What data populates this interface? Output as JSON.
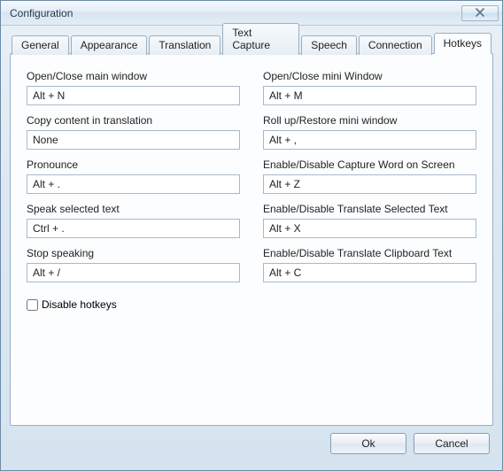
{
  "window": {
    "title": "Configuration"
  },
  "tabs": {
    "general": "General",
    "appearance": "Appearance",
    "translation": "Translation",
    "textcapture": "Text Capture",
    "speech": "Speech",
    "connection": "Connection",
    "hotkeys": "Hotkeys"
  },
  "hotkeys": {
    "open_main": {
      "label": "Open/Close main window",
      "value": "Alt + N"
    },
    "open_mini": {
      "label": "Open/Close mini Window",
      "value": "Alt + M"
    },
    "copy_translation": {
      "label": "Copy content in translation",
      "value": "None"
    },
    "rollup_mini": {
      "label": "Roll up/Restore mini window",
      "value": "Alt + ,"
    },
    "pronounce": {
      "label": "Pronounce",
      "value": "Alt + ."
    },
    "capture_screen": {
      "label": "Enable/Disable Capture Word on Screen",
      "value": "Alt + Z"
    },
    "speak_selected": {
      "label": "Speak selected text",
      "value": "Ctrl + ."
    },
    "trans_selected": {
      "label": "Enable/Disable Translate Selected Text",
      "value": "Alt + X"
    },
    "stop_speaking": {
      "label": "Stop speaking",
      "value": "Alt + /"
    },
    "trans_clipboard": {
      "label": "Enable/Disable Translate Clipboard Text",
      "value": "Alt + C"
    }
  },
  "disable_hotkeys_label": "Disable hotkeys",
  "buttons": {
    "ok": "Ok",
    "cancel": "Cancel"
  }
}
